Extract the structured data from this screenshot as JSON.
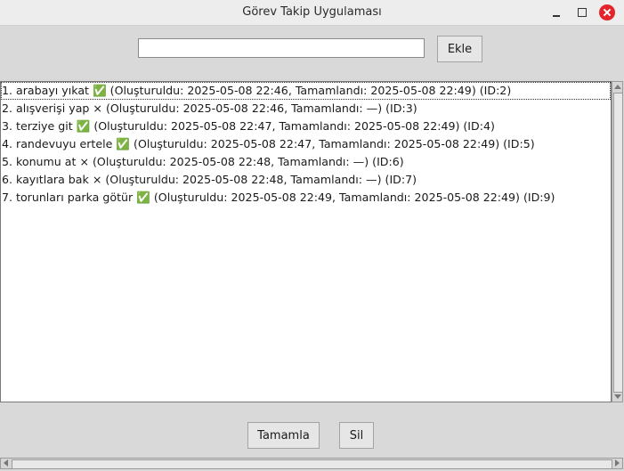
{
  "window": {
    "title": "Görev Takip Uygulaması"
  },
  "task_entry": {
    "value": "",
    "add_label": "Ekle"
  },
  "tasks": [
    "1. arabayı yıkat ✅ (Oluşturuldu: 2025-05-08 22:46, Tamamlandı: 2025-05-08 22:49) (ID:2)",
    "2. alışverişi yap × (Oluşturuldu: 2025-05-08 22:46, Tamamlandı: —) (ID:3)",
    "3. terziye git ✅ (Oluşturuldu: 2025-05-08 22:47, Tamamlandı: 2025-05-08 22:49) (ID:4)",
    "4. randevuyu ertele ✅ (Oluşturuldu: 2025-05-08 22:47, Tamamlandı: 2025-05-08 22:49) (ID:5)",
    "5. konumu at × (Oluşturuldu: 2025-05-08 22:48, Tamamlandı: —) (ID:6)",
    "6. kayıtlara bak × (Oluşturuldu: 2025-05-08 22:48, Tamamlandı: —) (ID:7)",
    "7. torunları parka götür ✅ (Oluşturuldu: 2025-05-08 22:49, Tamamlandı: 2025-05-08 22:49) (ID:9)"
  ],
  "actions": {
    "complete_label": "Tamamla",
    "delete_label": "Sil"
  }
}
